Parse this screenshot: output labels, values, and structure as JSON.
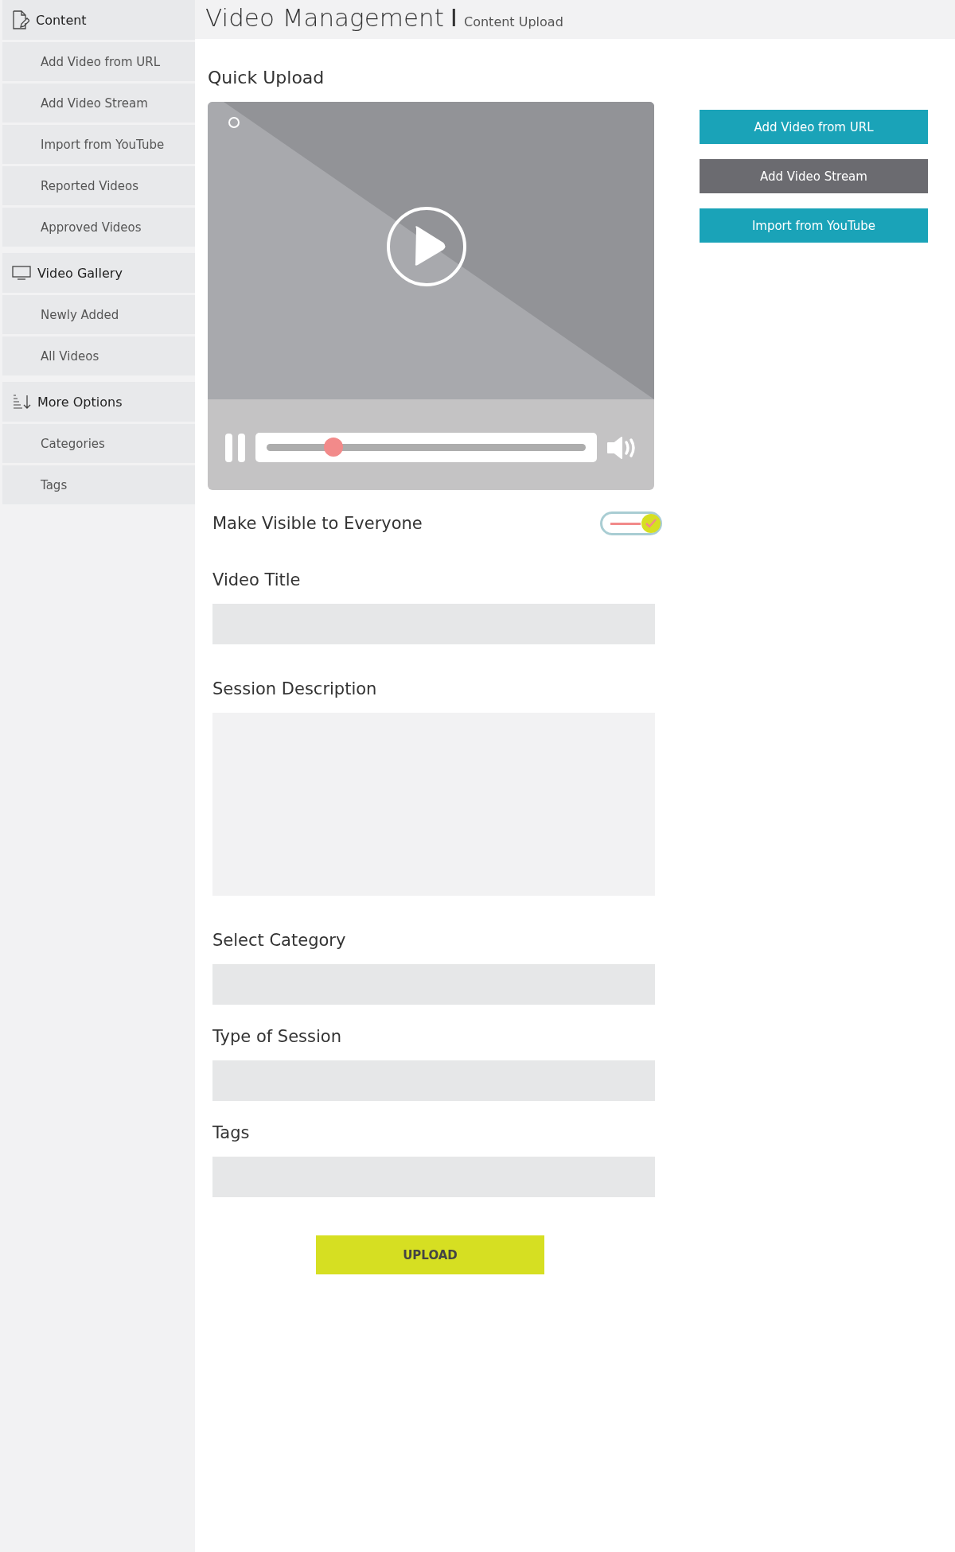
{
  "header": {
    "title": "Video Management",
    "separator": "I",
    "subtitle": "Content Upload"
  },
  "sidebar": {
    "sections": [
      {
        "title": "Content",
        "kind": "document",
        "items": [
          {
            "label": "Add Video from URL"
          },
          {
            "label": "Add Video Stream"
          },
          {
            "label": "Import from YouTube"
          },
          {
            "label": "Reported Videos"
          },
          {
            "label": "Approved Videos"
          }
        ]
      },
      {
        "title": "Video Gallery",
        "kind": "monitor",
        "items": [
          {
            "label": "Newly Added"
          },
          {
            "label": "All Videos"
          }
        ]
      },
      {
        "title": "More Options",
        "kind": "sort",
        "items": [
          {
            "label": "Categories"
          },
          {
            "label": "Tags"
          }
        ]
      }
    ]
  },
  "section_title": "Quick Upload",
  "player": {
    "level": 0.21
  },
  "visibility": {
    "label": "Make Visible to Everyone",
    "on": true
  },
  "fields": [
    {
      "label": "Video Title",
      "kind": "text"
    },
    {
      "label": "Session Description",
      "kind": "textarea"
    },
    {
      "label": "Select Category",
      "kind": "text"
    },
    {
      "label": "Type of Session",
      "kind": "text"
    },
    {
      "label": "Tags",
      "kind": "text"
    }
  ],
  "upload_button": "UPLOAD",
  "actions": [
    {
      "label": "Add Video from URL",
      "color": "#1aa3b8"
    },
    {
      "label": "Add Video Stream",
      "color": "#6b6b70"
    },
    {
      "label": "Import from YouTube",
      "color": "#1aa3b8"
    }
  ]
}
